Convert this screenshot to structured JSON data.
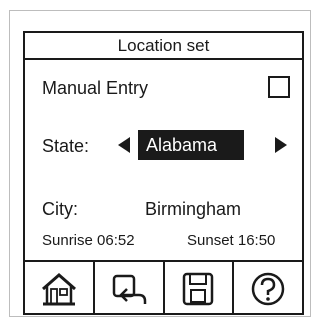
{
  "title": "Location set",
  "manual_entry": {
    "label": "Manual Entry",
    "checked": false
  },
  "state": {
    "label": "State:",
    "value": "Alabama"
  },
  "city": {
    "label": "City:",
    "value": "Birmingham"
  },
  "sun": {
    "sunrise": "Sunrise 06:52",
    "sunset": "Sunset 16:50"
  },
  "toolbar": [
    {
      "icon": "home-icon"
    },
    {
      "icon": "back-icon"
    },
    {
      "icon": "save-icon"
    },
    {
      "icon": "help-icon"
    }
  ]
}
